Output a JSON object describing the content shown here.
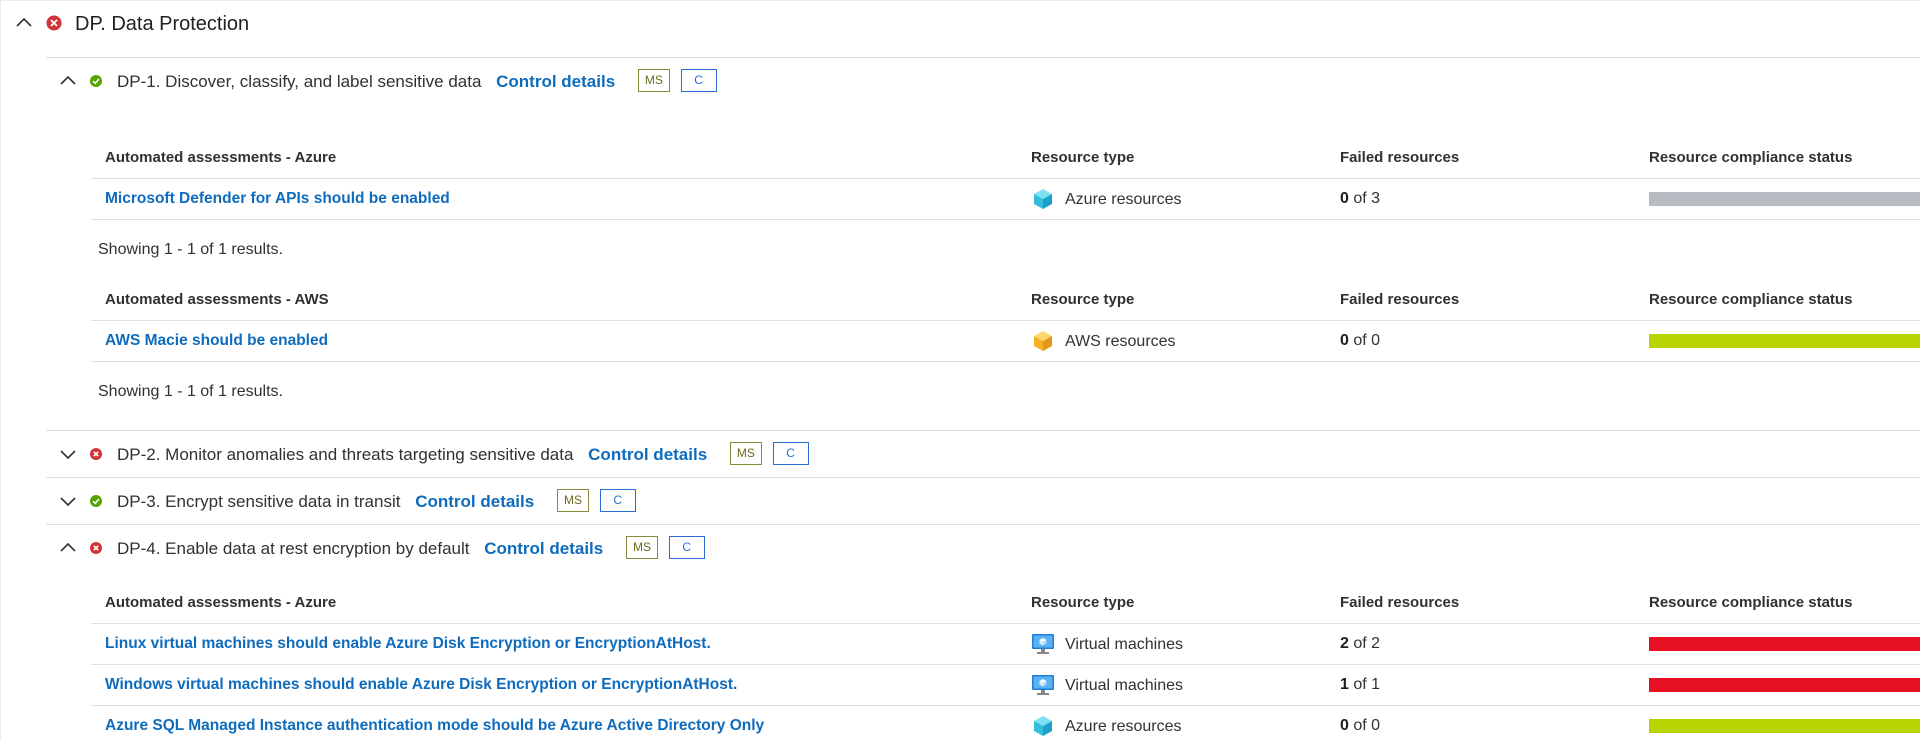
{
  "section": {
    "title": "DP. Data Protection",
    "status": "failed"
  },
  "colors": {
    "link": "#0f6cbd",
    "failed_icon": "#d13438",
    "passed_icon": "#57a300",
    "bar_gray": "#b7bcc2",
    "bar_green": "#b8d400",
    "bar_red": "#e81123",
    "tag_ms": "#8a8a3e",
    "tag_c": "#2b6cd6"
  },
  "control_link_label": "Control details",
  "tag_ms_label": "MS",
  "tag_c_label": "C",
  "column_labels": {
    "resource_type": "Resource type",
    "failed_resources": "Failed resources",
    "compliance_status": "Resource compliance status"
  },
  "controls": [
    {
      "title": "DP-1. Discover, classify, and label sensitive data",
      "status": "passed",
      "expanded": true
    },
    {
      "title": "DP-2. Monitor anomalies and threats targeting sensitive data",
      "status": "failed",
      "expanded": false
    },
    {
      "title": "DP-3. Encrypt sensitive data in transit",
      "status": "passed",
      "expanded": false
    },
    {
      "title": "DP-4. Enable data at rest encryption by default",
      "status": "failed",
      "expanded": true
    }
  ],
  "tables": [
    {
      "heading": "Automated assessments - Azure",
      "rows": [
        {
          "name": "Microsoft Defender for APIs should be enabled",
          "resource_type": "Azure resources",
          "icon": "azure-cube-icon",
          "failed": "0",
          "of_total": "of 3",
          "compliance": "gray"
        }
      ],
      "showing": "Showing 1 - 1 of 1 results."
    },
    {
      "heading": "Automated assessments - AWS",
      "rows": [
        {
          "name": "AWS Macie should be enabled",
          "resource_type": "AWS resources",
          "icon": "aws-cube-icon",
          "failed": "0",
          "of_total": "of 0",
          "compliance": "green"
        }
      ],
      "showing": "Showing 1 - 1 of 1 results."
    },
    {
      "heading": "Automated assessments - Azure",
      "rows": [
        {
          "name": "Linux virtual machines should enable Azure Disk Encryption or EncryptionAtHost.",
          "resource_type": "Virtual machines",
          "icon": "virtual-machine-icon",
          "failed": "2",
          "of_total": "of 2",
          "compliance": "red"
        },
        {
          "name": "Windows virtual machines should enable Azure Disk Encryption or EncryptionAtHost.",
          "resource_type": "Virtual machines",
          "icon": "virtual-machine-icon",
          "failed": "1",
          "of_total": "of 1",
          "compliance": "red"
        },
        {
          "name": "Azure SQL Managed Instance authentication mode should be Azure Active Directory Only",
          "resource_type": "Azure resources",
          "icon": "azure-cube-icon",
          "failed": "0",
          "of_total": "of 0",
          "compliance": "green"
        }
      ]
    }
  ]
}
